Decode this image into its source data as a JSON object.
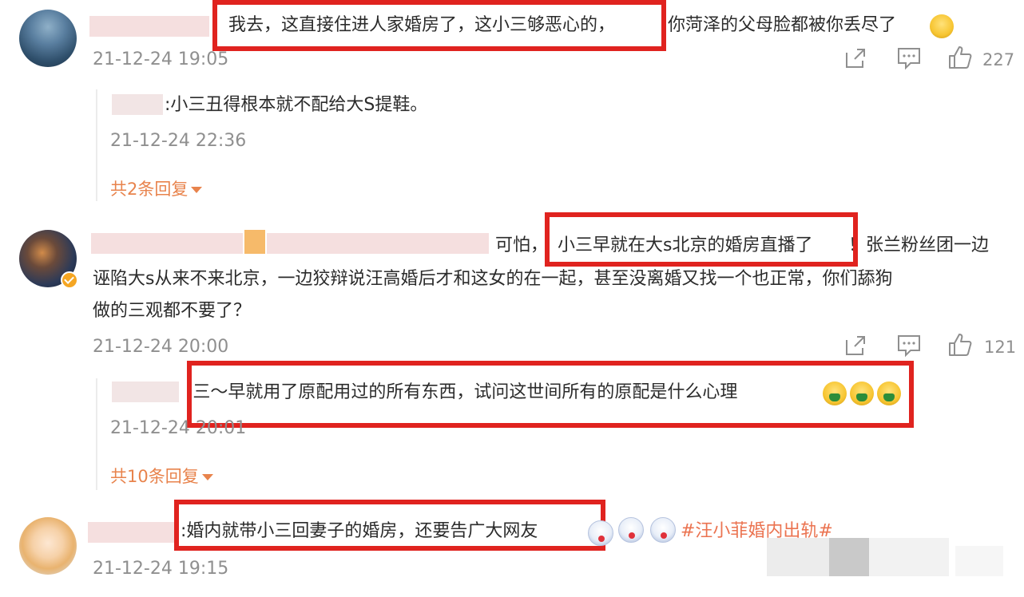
{
  "comments": [
    {
      "text_highlight": "我去，这直接住进人家婚房了，这小三够恶心的，",
      "text_rest": "你菏泽的父母脸都被你丢尽了",
      "time": "21-12-24 19:05",
      "likes": "227",
      "reply": {
        "text": ":小三丑得根本就不配给大S提鞋。",
        "time": "21-12-24 22:36"
      },
      "more_replies": "共2条回复"
    },
    {
      "text_before": "可怕，",
      "text_highlight": "小三早就在大s北京的婚房直播了",
      "text_line1_rest": "！张兰粉丝团一边",
      "text_line2": "诬陷大s从来不来北京，一边狡辩说汪高婚后才和这女的在一起，甚至没离婚又找一个也正常，你们舔狗",
      "text_line3": "做的三观都不要了？",
      "time": "21-12-24 20:00",
      "likes": "121",
      "reply": {
        "text": ":三～早就用了原配用过的所有东西，试问这世间所有的原配是什么心理",
        "time": "21-12-24 20:01"
      },
      "more_replies": "共10条回复"
    },
    {
      "text_highlight": ":婚内就带小三回妻子的婚房，还要告广大网友",
      "hashtag": "#汪小菲婚内出轨#",
      "time": "21-12-24 19:15"
    }
  ],
  "icons": {
    "share": "share-icon",
    "comment": "comment-icon",
    "like": "thumbs-up-icon",
    "caret": "caret-down-icon",
    "verified": "verified-badge-icon"
  },
  "colors": {
    "highlight_box": "#e0231f",
    "link_orange": "#e8834c",
    "meta_gray": "#8f8f8f",
    "hashtag": "#eb7350"
  }
}
